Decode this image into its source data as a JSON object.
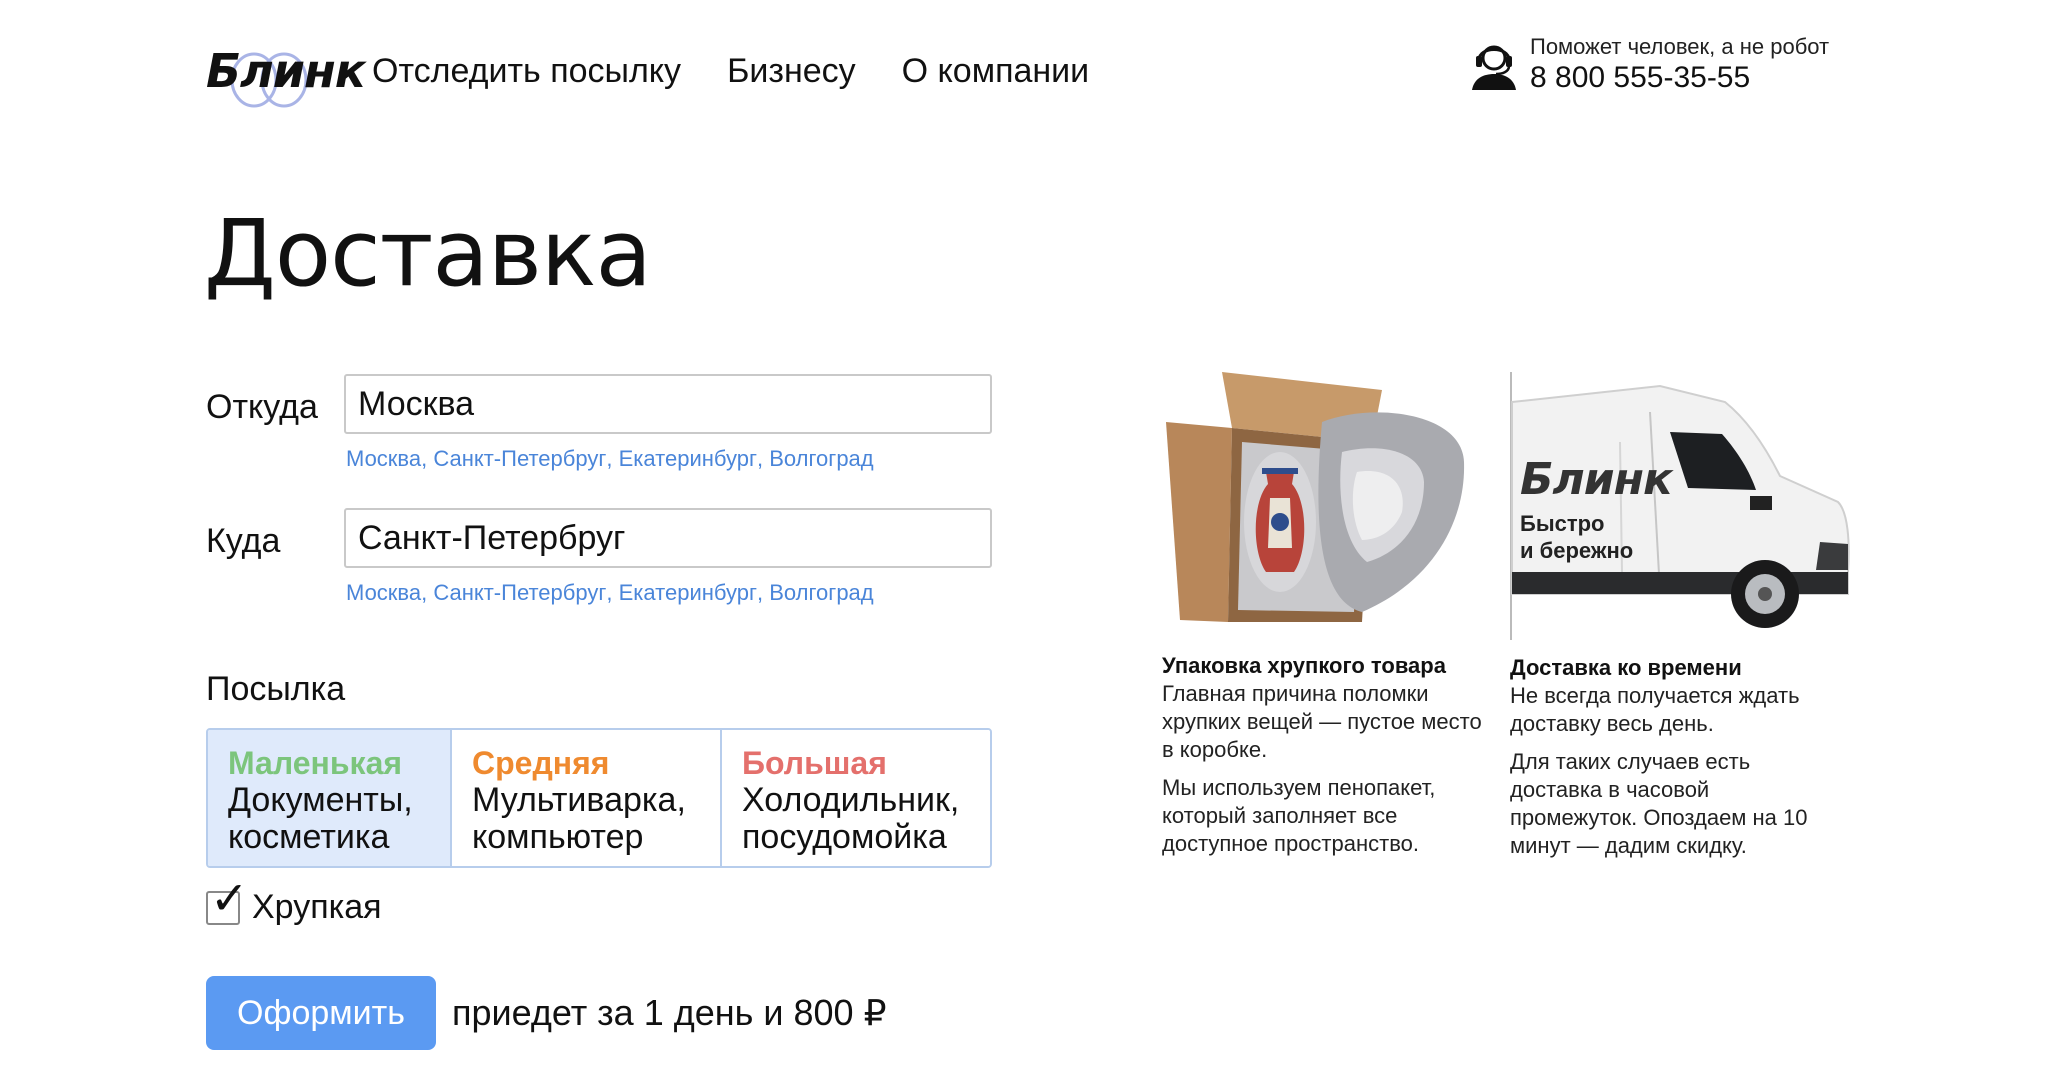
{
  "header": {
    "logo": "Блинк",
    "nav": [
      {
        "label": "Отследить посылку"
      },
      {
        "label": "Бизнесу"
      },
      {
        "label": "О компании"
      }
    ],
    "support_note": "Поможет человек, а не робот",
    "phone": "8 800 555-35-55"
  },
  "page_title": "Доставка",
  "form": {
    "from_label": "Откуда",
    "from_value": "Москва",
    "to_label": "Куда",
    "to_value": "Санкт-Петербруг",
    "suggestions": [
      "Москва",
      "Санкт-Петербруг",
      "Екатеринбург",
      "Волгоград"
    ],
    "parcel_label": "Посылка",
    "sizes": [
      {
        "name": "Маленькая",
        "desc1": "Документы,",
        "desc2": "косметика",
        "color": "#7cc57c",
        "selected": true
      },
      {
        "name": "Средняя",
        "desc1": "Мультиварка,",
        "desc2": "компьютер",
        "color": "#ef8a2f",
        "selected": false
      },
      {
        "name": "Большая",
        "desc1": "Холодильник,",
        "desc2": "посудомойка",
        "color": "#e4706c",
        "selected": false
      }
    ],
    "fragile_label": "Хрупкая",
    "fragile_checked": true,
    "submit_label": "Оформить",
    "estimate": "приедет за 1 день и 800 ₽"
  },
  "cards": [
    {
      "title": "Упаковка хрупкого товара",
      "p1": "Главная причина поломки хрупких вещей — пустое место в коробке.",
      "p2": "Мы используем пенопакет, который заполняет все доступное пространство."
    },
    {
      "title": "Доставка ко времени",
      "p1": "Не всегда получается ждать доставку весь день.",
      "p2": "Для таких случаев есть доставка в часовой промежуток. Опоздаем на 10 минут — дадим скидку.",
      "van_brand": "Блинк",
      "van_slogan1": "Быстро",
      "van_slogan2": "и бережно"
    }
  ],
  "colors": {
    "accent": "#5b9af2",
    "link": "#4a85d9",
    "selected_bg": "#dfeafb"
  }
}
